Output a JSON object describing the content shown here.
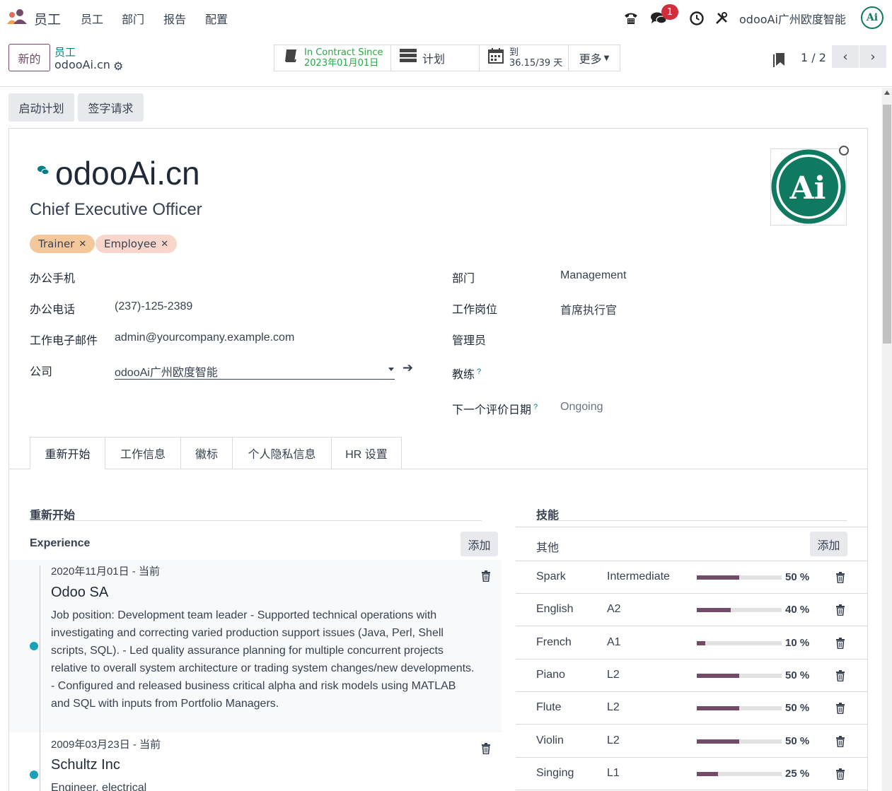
{
  "navbar": {
    "app_name": "员工",
    "menu": [
      "员工",
      "部门",
      "报告",
      "配置"
    ],
    "message_count": "1",
    "company": "odooAi广州欧度智能",
    "avatar_text": "Ai"
  },
  "control": {
    "new_label": "新的",
    "breadcrumb_parent": "员工",
    "breadcrumb_current": "odooAi.cn",
    "contract_label": "In Contract Since",
    "contract_date": "2023年01月01日",
    "plan_label": "计划",
    "to_label": "到",
    "to_value": "36.15/39 天",
    "more_label": "更多",
    "pager": "1 / 2"
  },
  "status_buttons": [
    "启动计划",
    "签字请求"
  ],
  "employee": {
    "name": "odooAi.cn",
    "job_title": "Chief Executive Officer",
    "tags": [
      {
        "label": "Trainer",
        "color": "#f5c89c"
      },
      {
        "label": "Employee",
        "color": "#f9d6cc"
      }
    ],
    "photo_text": "Ai"
  },
  "fields_left": [
    {
      "label": "办公手机",
      "value": ""
    },
    {
      "label": "办公电话",
      "value": "(237)-125-2389"
    },
    {
      "label": "工作电子邮件",
      "value": "admin@yourcompany.example.com"
    },
    {
      "label": "公司",
      "value": "odooAi广州欧度智能"
    }
  ],
  "fields_right": [
    {
      "label": "部门",
      "value": "Management"
    },
    {
      "label": "工作岗位",
      "value": "首席执行官"
    },
    {
      "label": "管理员",
      "value": ""
    },
    {
      "label": "教练",
      "value": ""
    },
    {
      "label": "下一个评价日期",
      "value": "Ongoing"
    }
  ],
  "help_mark": "?",
  "tabs": [
    "重新开始",
    "工作信息",
    "徽标",
    "个人隐私信息",
    "HR 设置"
  ],
  "resume": {
    "title": "重新开始",
    "group": "Experience",
    "add_label": "添加",
    "items": [
      {
        "date": "2020年11月01日 - 当前",
        "company": "Odoo SA",
        "description": "Job position: Development team leader - Supported technical operations with investigating and correcting varied production support issues (Java, Perl, Shell scripts, SQL). - Led quality assurance planning for multiple concurrent projects relative to overall system architecture or trading system changes/new developments. - Configured and released business critical alpha and risk models using MATLAB and SQL with inputs from Portfolio Managers."
      },
      {
        "date": "2009年03月23日 - 当前",
        "company": "Schultz Inc",
        "description": "Engineer, electrical"
      }
    ]
  },
  "skills": {
    "title": "技能",
    "group": "其他",
    "add_label": "添加",
    "items": [
      {
        "name": "Spark",
        "level": "Intermediate",
        "progress": 50,
        "pct": "50 %"
      },
      {
        "name": "English",
        "level": "A2",
        "progress": 40,
        "pct": "40 %"
      },
      {
        "name": "French",
        "level": "A1",
        "progress": 10,
        "pct": "10 %"
      },
      {
        "name": "Piano",
        "level": "L2",
        "progress": 50,
        "pct": "50 %"
      },
      {
        "name": "Flute",
        "level": "L2",
        "progress": 50,
        "pct": "50 %"
      },
      {
        "name": "Violin",
        "level": "L2",
        "progress": 50,
        "pct": "50 %"
      },
      {
        "name": "Singing",
        "level": "L1",
        "progress": 25,
        "pct": "25 %"
      }
    ]
  }
}
